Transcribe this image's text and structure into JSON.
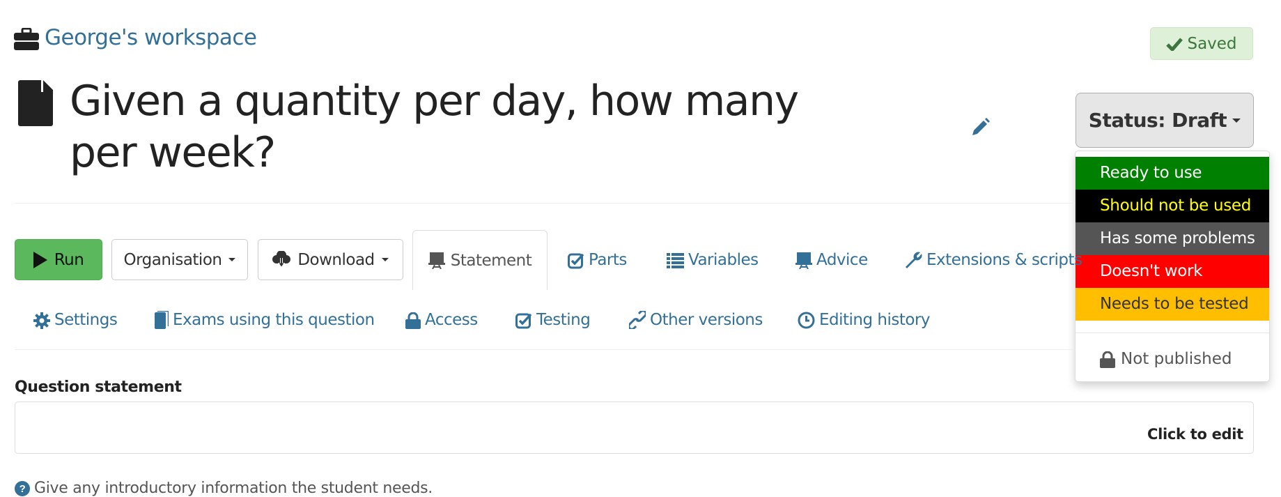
{
  "workspace": {
    "label": "George's workspace",
    "icon": "briefcase-icon"
  },
  "save_status": {
    "label": "Saved",
    "icon": "check-icon"
  },
  "question": {
    "title": "Given a quantity per day, how many per week?",
    "icon": "file-icon"
  },
  "status": {
    "button_label": "Status: Draft",
    "options": [
      {
        "label": "Ready to use",
        "bg": "#008000",
        "fg": "#ffffff"
      },
      {
        "label": "Should not be used",
        "bg": "#000000",
        "fg": "#ffff00"
      },
      {
        "label": "Has some problems",
        "bg": "#555555",
        "fg": "#ffffff"
      },
      {
        "label": "Doesn't work",
        "bg": "#ff0000",
        "fg": "#ffffff"
      },
      {
        "label": "Needs to be tested",
        "bg": "#ffbf00",
        "fg": "#333333"
      }
    ],
    "published_label": "Not published"
  },
  "toolbar": {
    "run_label": "Run",
    "organisation_label": "Organisation",
    "download_label": "Download"
  },
  "tabs": {
    "row1": [
      {
        "label": "Statement",
        "active": true
      },
      {
        "label": "Parts"
      },
      {
        "label": "Variables"
      },
      {
        "label": "Advice"
      },
      {
        "label": "Extensions & scripts"
      }
    ],
    "row2": [
      {
        "label": "Settings"
      },
      {
        "label": "Exams using this question"
      },
      {
        "label": "Access"
      },
      {
        "label": "Testing"
      },
      {
        "label": "Other versions"
      },
      {
        "label": "Editing history"
      }
    ]
  },
  "statement": {
    "label": "Question statement",
    "click_to_edit": "Click to edit",
    "help": "Give any introductory information the student needs."
  },
  "colors": {
    "link": "#337098",
    "run": "#5cb85c",
    "saved_bg": "#dff0d8",
    "saved_fg": "#3c763d"
  }
}
